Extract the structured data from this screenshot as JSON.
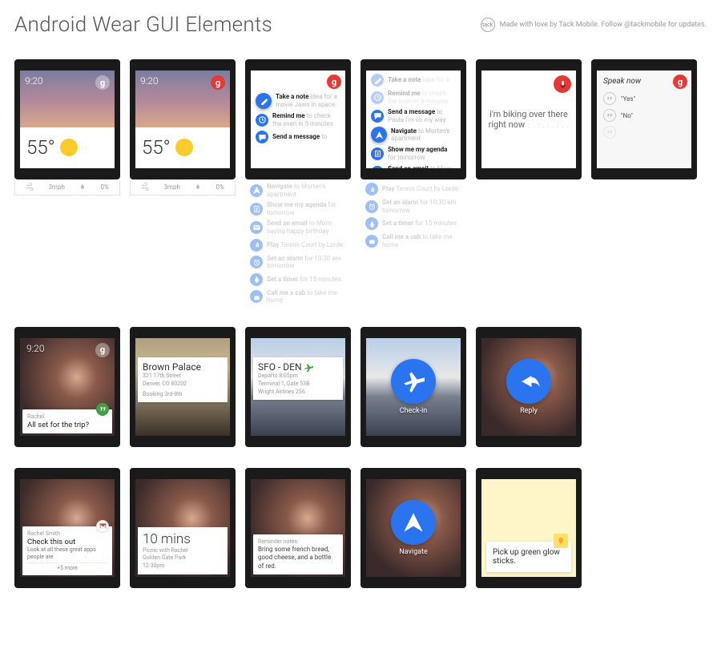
{
  "header": {
    "title": "Android Wear GUI Elements",
    "credit": "Made with love by Tack Mobile. Follow @tackmobile for updates.",
    "logo_text": "tack"
  },
  "weather": {
    "time": "9:20",
    "temp": "55°",
    "wind": "3mph",
    "precip": "0%",
    "g_label": "g"
  },
  "cue_top": {
    "items": [
      {
        "icon": "pencil",
        "bold": "Take a note",
        "sub": " idea for a movie Jaws in space"
      },
      {
        "icon": "clock",
        "bold": "Remind me",
        "sub": " to check the oven in 5 minutes"
      },
      {
        "icon": "chat",
        "bold": "Send a message",
        "sub": " to"
      }
    ]
  },
  "cue_full": [
    {
      "icon": "pencil",
      "bold": "Take a note",
      "sub": " idea for a"
    },
    {
      "icon": "clock",
      "bold": "Remind me",
      "sub": " to check the oven in 5 minutes"
    },
    {
      "icon": "chat",
      "bold": "Send a message",
      "sub": " to Paula I'm on my way"
    },
    {
      "icon": "nav",
      "bold": "Navigate",
      "sub": " to Morten's apartment"
    },
    {
      "icon": "agenda",
      "bold": "Show me my agenda",
      "sub": " for tomorrow"
    },
    {
      "icon": "mail",
      "bold": "Send an email",
      "sub": " to Mom saying happy birthday"
    },
    {
      "icon": "music",
      "bold": "Play",
      "sub": " Tennis Court by Lorde"
    },
    {
      "icon": "alarm",
      "bold": "Set an alarm",
      "sub": " for 10:30 am tomorrow"
    },
    {
      "icon": "timer",
      "bold": "Set a timer",
      "sub": " for 15 minutes"
    },
    {
      "icon": "car",
      "bold": "Call me a cab",
      "sub": " to take me home"
    }
  ],
  "cue_nav_selected": 3,
  "voice": {
    "text": "i'm biking over there right now",
    "waves": ": . : .  : . : . ."
  },
  "speak": {
    "prompt": "Speak now",
    "opt_yes": "\"Yes\"",
    "opt_no": "\"No\""
  },
  "row2": {
    "hangouts": {
      "time": "9:20",
      "from": "Rachel",
      "msg": "All set for the trip?"
    },
    "hotel": {
      "name": "Brown Palace",
      "addr1": "321 17th Street",
      "addr2": "Denver, CO 80202",
      "dates": "Booking 3rd-8th"
    },
    "flight": {
      "route": "SFO - DEN",
      "depart": "Departs 8:05pm",
      "term": "Terminal 1, Gate 53B",
      "carrier": "Wright Airlines 256"
    },
    "checkin": {
      "label": "Check-in"
    },
    "reply": {
      "label": "Reply"
    }
  },
  "row3": {
    "gmail": {
      "from": "Rachel Smith",
      "subj": "Check this out",
      "body": "Look at all these great apps people are",
      "more": "+5 more"
    },
    "eta": {
      "big": "10 mins",
      "l1": "Picnic with Rachel",
      "l2": "Golden Gate Park",
      "l3": "12:30pm"
    },
    "reminder": {
      "head": "Reminder notes:",
      "body": "Bring some french bread, good cheese, and a bottle of red."
    },
    "navigate": {
      "label": "Navigate"
    },
    "keep": {
      "note": "Pick up green glow sticks."
    }
  }
}
